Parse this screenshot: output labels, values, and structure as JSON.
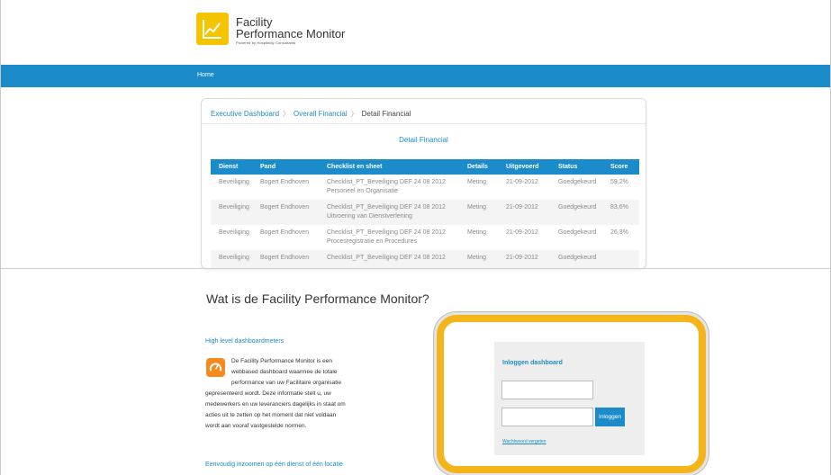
{
  "brand": {
    "line1": "Facility",
    "line2": "Performance Monitor",
    "powered": "Powered by Hospitality Consultants",
    "accent": "#f5c400"
  },
  "nav": {
    "home": "Home",
    "color": "#1b8cc9"
  },
  "dashboard": {
    "breadcrumbs": [
      "Executive Dashboard",
      "Overall Financial",
      "Detail Financial"
    ],
    "title": "Detail Financial",
    "columns": [
      "Dienst",
      "Pand",
      "Checklist en sheet",
      "Details",
      "Uitgevoerd",
      "Status",
      "Score"
    ],
    "rows": [
      [
        "Beveiliging",
        "Bogert Endhoven",
        "Checklist_PT_Beveiliging DEF 24 08 2012 Personeel en Organisatie",
        "Meting",
        "21-09-2012",
        "Goedgekeurd",
        "59,2%"
      ],
      [
        "Beveiliging",
        "Bogert Endhoven",
        "Checklist_PT_Beveiliging DEF 24 08 2012 Uitvoering van Dienstverlening",
        "Meting",
        "21-09-2012",
        "Goedgekeurd",
        "83,6%"
      ],
      [
        "Beveiliging",
        "Bogert Endhoven",
        "Checklist_PT_Beveiliging DEF 24 08 2012 Procesregistratie en Procedures",
        "Meting",
        "21-09-2012",
        "Goedgekeurd",
        "26,3%"
      ],
      [
        "Beveiliging",
        "Bogert Endhoven",
        "Checklist_PT_Beveiliging DEF 24 08 2012",
        "Meting",
        "21-09-2012",
        "Goedgekeurd",
        ""
      ]
    ]
  },
  "info": {
    "heading": "Wat is de Facility Performance Monitor?",
    "sub1": "High level dashboardmeters",
    "desc_lines": [
      "De Facility Performance Monitor is een",
      "webbased dashboard waarmee de totale",
      "performance van uw Facilitaire organisatie",
      "gepresenteerd wordt. Deze informatie stelt u, uw",
      "medewerkers en uw leveranciers dagelijks in staat om",
      "acties uit te zetten op het moment dat niet voldaan",
      "wordt aan vooraf vastgestelde normen."
    ],
    "sub2": "Eenvoudig inzoomen op één dienst of één locatie"
  },
  "login": {
    "title": "Inloggen dashboard",
    "username_value": "",
    "password_value": "",
    "button": "Inloggen",
    "forgot": "Wachtwoord vergeten",
    "highlight": "#f3b51a"
  }
}
